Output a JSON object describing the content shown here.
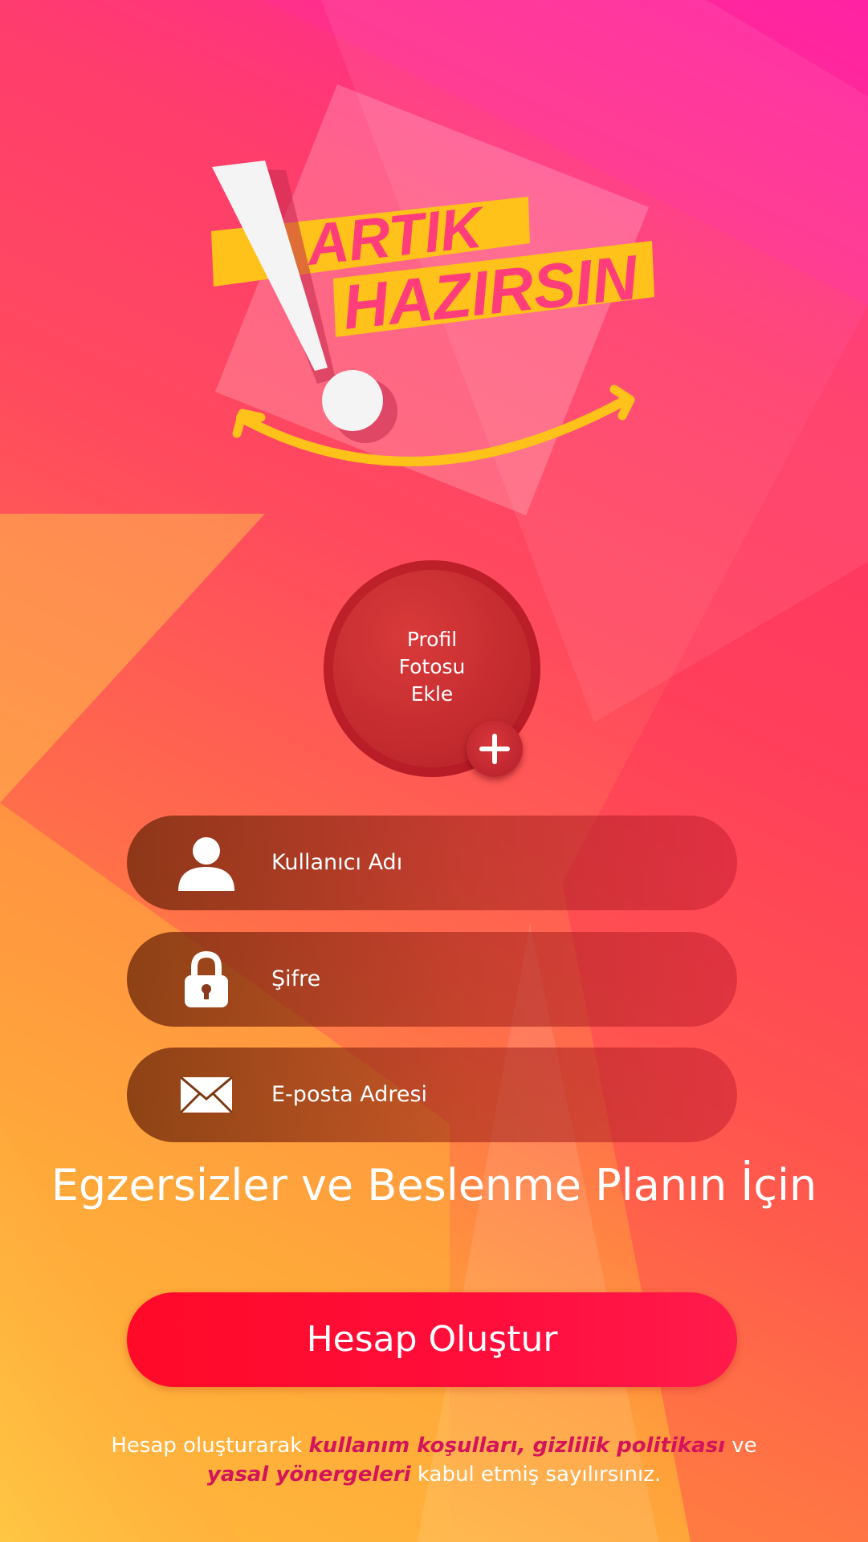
{
  "logo": {
    "line1": "ARTIK",
    "line2": "HAZIRSIN"
  },
  "profile": {
    "label": "Profil\nFotosu\nEkle"
  },
  "fields": {
    "username": {
      "label": "Kullanıcı Adı",
      "icon": "user-icon"
    },
    "password": {
      "label": "Şifre",
      "icon": "lock-icon"
    },
    "email": {
      "label": "E-posta Adresi",
      "icon": "envelope-icon"
    }
  },
  "headline": "Egzersizler ve Beslenme Planın İçin",
  "cta": {
    "label": "Hesap Oluştur"
  },
  "terms": {
    "prefix": "Hesap oluşturarak ",
    "link1": "kullanım koşulları, gizlilik politikası",
    "middle": " ve ",
    "link2": "yasal yönergeleri",
    "suffix": " kabul etmiş sayılırsınız."
  },
  "colors": {
    "accent": "#ff0a28",
    "logo_yellow": "#ffc21a",
    "link": "#d4145a"
  }
}
